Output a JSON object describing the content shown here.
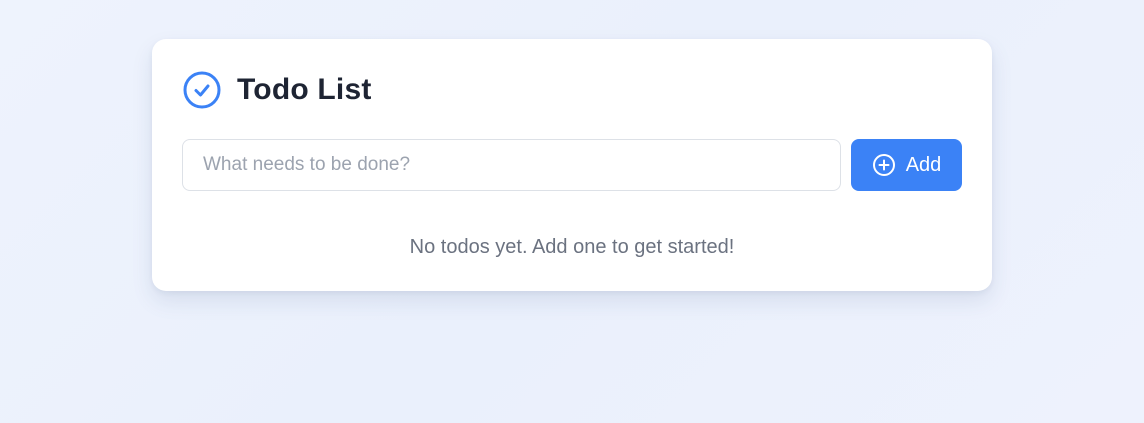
{
  "header": {
    "title": "Todo List",
    "icon": "check-circle-icon"
  },
  "form": {
    "input_value": "",
    "input_placeholder": "What needs to be done?",
    "add_label": "Add",
    "add_icon": "plus-circle-icon"
  },
  "empty_state": {
    "message": "No todos yet. Add one to get started!"
  },
  "colors": {
    "accent": "#3b82f6",
    "title_text": "#1e2433",
    "muted_text": "#6b7280",
    "placeholder_text": "#9ca3af",
    "background": "#eef3fd"
  }
}
